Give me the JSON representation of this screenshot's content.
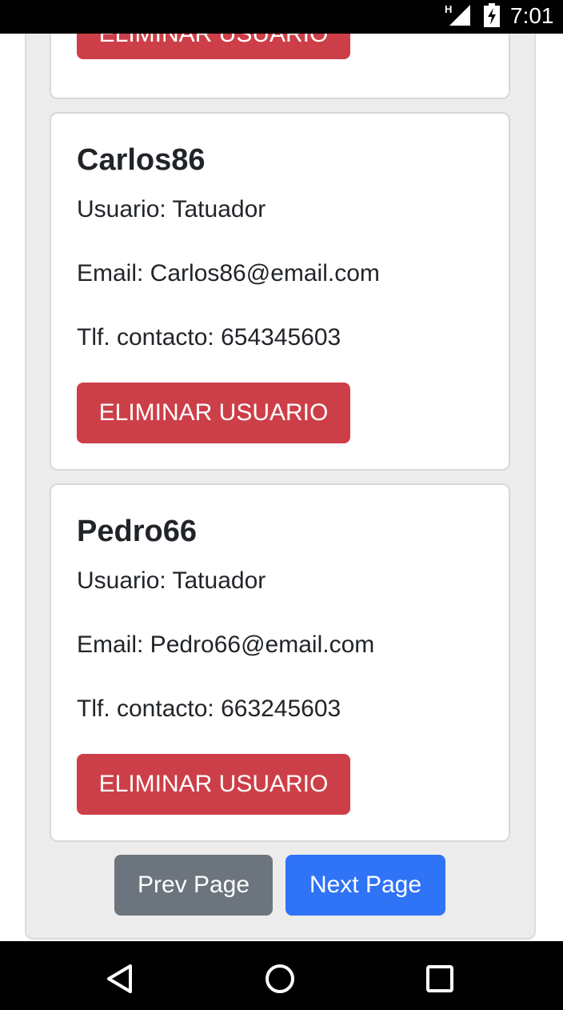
{
  "status_bar": {
    "network_label": "H",
    "time": "7:01",
    "icons": [
      "signal-icon",
      "battery-charging-icon"
    ]
  },
  "users": [
    {
      "name": "",
      "delete_label": "ELIMINAR USUARIO"
    },
    {
      "name": "Carlos86",
      "type_line": "Usuario: Tatuador",
      "email_line": "Email: Carlos86@email.com",
      "phone_line": "Tlf. contacto: 654345603",
      "delete_label": "ELIMINAR USUARIO"
    },
    {
      "name": "Pedro66",
      "type_line": "Usuario: Tatuador",
      "email_line": "Email: Pedro66@email.com",
      "phone_line": "Tlf. contacto: 663245603",
      "delete_label": "ELIMINAR USUARIO"
    }
  ],
  "pagination": {
    "prev_label": "Prev Page",
    "next_label": "Next Page"
  },
  "nav_bar": {
    "icons": [
      "back-icon",
      "home-icon",
      "recents-icon"
    ]
  },
  "colors": {
    "danger": "#cd3f48",
    "secondary": "#6c757d",
    "primary": "#2f73f7"
  }
}
